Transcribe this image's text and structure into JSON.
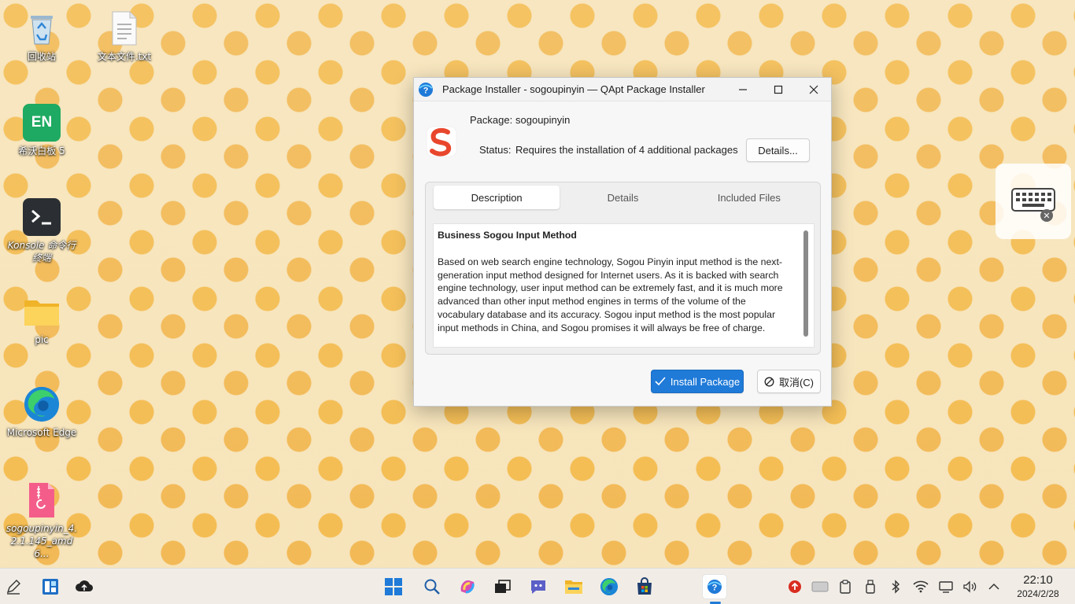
{
  "desktop": {
    "icons": [
      {
        "label": "回收站"
      },
      {
        "label": "文本文件.txt"
      },
      {
        "label": "希沃白板 5",
        "badge": "EN"
      },
      {
        "label": "Konsole 命令行终端"
      },
      {
        "label": "pic"
      },
      {
        "label": "Microsoft Edge"
      },
      {
        "label": "sogoupinyin_4.2.1.145_amd6..."
      }
    ]
  },
  "dialog": {
    "title": "Package Installer - sogoupinyin — QApt Package Installer",
    "package_label": "Package:",
    "package_value": "sogoupinyin",
    "status_label": "Status:",
    "status_value": "Requires the installation of 4 additional packages",
    "details_button": "Details...",
    "tabs": [
      {
        "label": "Description",
        "active": true
      },
      {
        "label": "Details",
        "active": false
      },
      {
        "label": "Included Files",
        "active": false
      }
    ],
    "description": {
      "heading": "Business Sogou Input Method",
      "body": "Based on web search engine technology, Sogou Pinyin input method is the next-generation input method designed for Internet users. As it is backed with search engine technology, user input method can be extremely fast, and it is much more advanced than other input method engines in terms of the volume of the vocabulary database and its accuracy. Sogou input method is the most popular input methods in China, and Sogou promises it will always be free of charge."
    },
    "install_button": "Install Package",
    "cancel_button": "取消(C)",
    "accent_color": "#1f7ad8"
  },
  "taskbar": {
    "clock_time": "22:10",
    "clock_date": "2024/2/28"
  }
}
